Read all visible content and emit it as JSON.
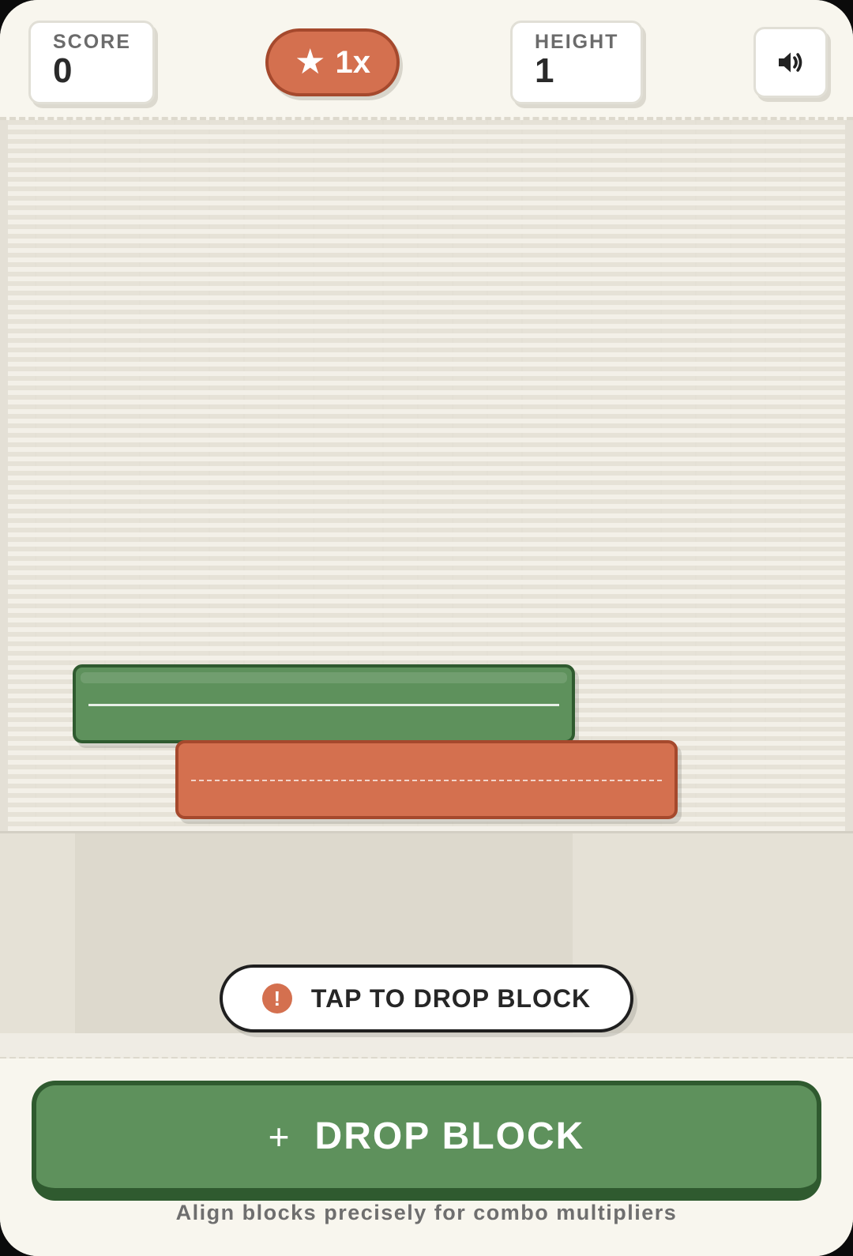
{
  "header": {
    "score": {
      "label": "SCORE",
      "value": "0"
    },
    "combo": {
      "icon": "star-icon",
      "glyph": "★",
      "label": "1x"
    },
    "height": {
      "label": "HEIGHT",
      "value": "1"
    },
    "sound": {
      "icon": "speaker-icon"
    }
  },
  "field": {
    "blocks": [
      {
        "name": "green-block",
        "color": "#5e915c"
      },
      {
        "name": "orange-block",
        "color": "#d4704f"
      }
    ],
    "hint": {
      "icon": "alert-icon",
      "glyph": "!",
      "text": "TAP TO DROP BLOCK"
    }
  },
  "footer": {
    "drop_button": {
      "icon": "plus-icon",
      "glyph": "+",
      "label": "DROP BLOCK"
    },
    "tagline": "Align blocks precisely for combo multipliers"
  },
  "colors": {
    "accent_green": "#5e915c",
    "accent_orange": "#d4704f",
    "background": "#f7f4ec"
  }
}
